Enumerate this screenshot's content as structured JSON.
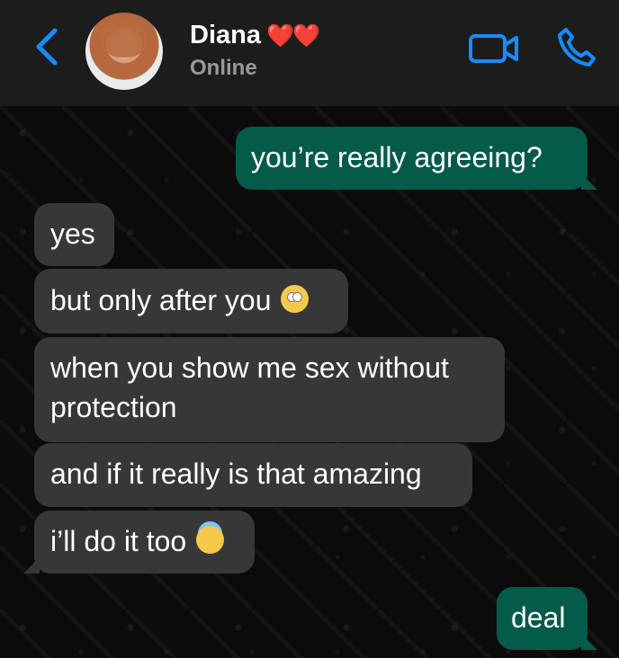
{
  "contact": {
    "name": "Diana",
    "hearts": "❤️❤️",
    "status": "Online"
  },
  "messages": [
    {
      "direction": "outgoing",
      "text": "you’re really agreeing?"
    },
    {
      "direction": "incoming",
      "text": "yes"
    },
    {
      "direction": "incoming",
      "text": "but only after you",
      "emoji": "eye-roll-emoji"
    },
    {
      "direction": "incoming",
      "text_line1": "when you show me sex without",
      "text_line2": "protection"
    },
    {
      "direction": "incoming",
      "text": "and if it really is that amazing"
    },
    {
      "direction": "incoming",
      "text": "i’ll do it too",
      "emoji": "angel-emoji"
    },
    {
      "direction": "outgoing",
      "text": "deal"
    }
  ],
  "icons": {
    "back": "chevron-left-icon",
    "video_call": "video-camera-icon",
    "voice_call": "phone-icon"
  },
  "colors": {
    "header": "#1c1c1c",
    "chat_background": "#0b0b0b",
    "incoming_bubble": "#373737",
    "outgoing_bubble": "#055b49",
    "accent": "#168cff"
  }
}
